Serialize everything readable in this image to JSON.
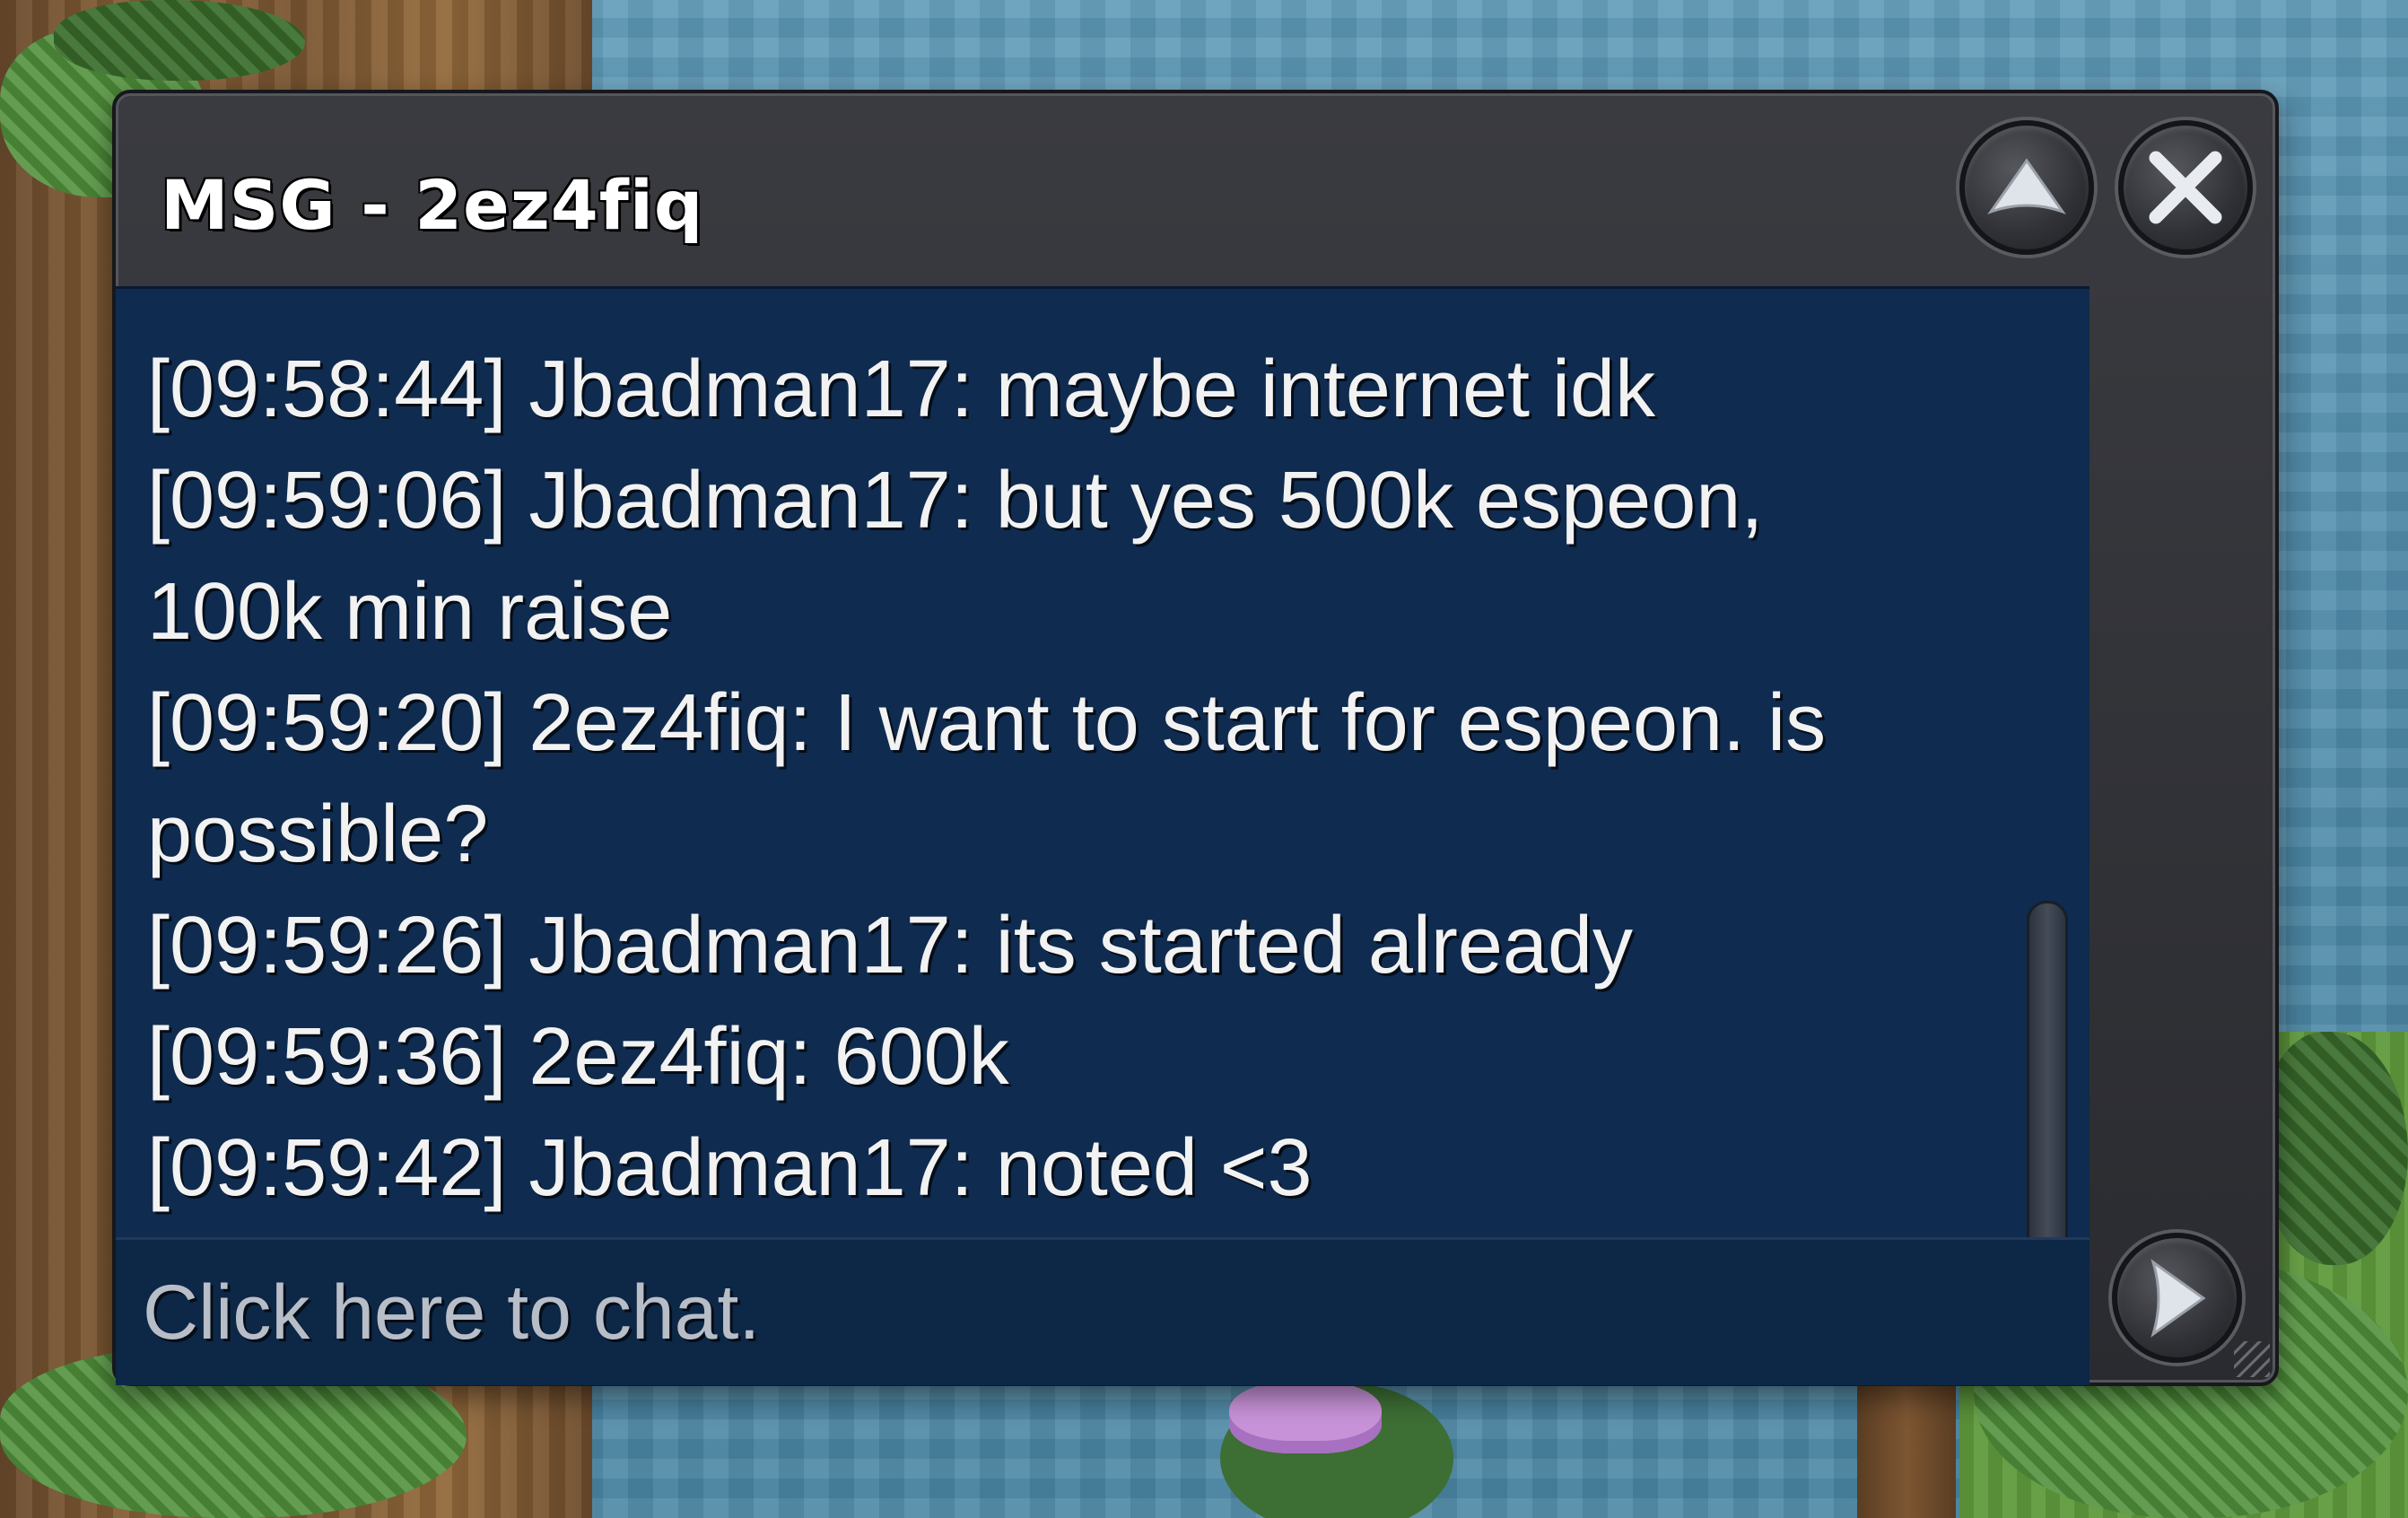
{
  "window": {
    "title": "MSG - 2ez4fiq"
  },
  "buttons": {
    "minimize_icon": "triangle-up-icon",
    "close_icon": "x-icon",
    "send_icon": "triangle-right-icon"
  },
  "messages": [
    {
      "text": "[09:58:44] Jbadman17: maybe internet idk"
    },
    {
      "text": "[09:59:06] Jbadman17: but yes 500k espeon,\n100k min raise"
    },
    {
      "text": "[09:59:20] 2ez4fiq: I want to start for espeon. is\npossible?"
    },
    {
      "text": "[09:59:26] Jbadman17: its started already"
    },
    {
      "text": "[09:59:36] 2ez4fiq: 600k"
    },
    {
      "text": "[09:59:42] Jbadman17: noted <3"
    }
  ],
  "chat_input": {
    "placeholder": "Click here to chat.",
    "value": ""
  },
  "colors": {
    "window_frame": "#2e2f34",
    "message_area": "#0f2b4f",
    "text": "#f2f2f2"
  }
}
